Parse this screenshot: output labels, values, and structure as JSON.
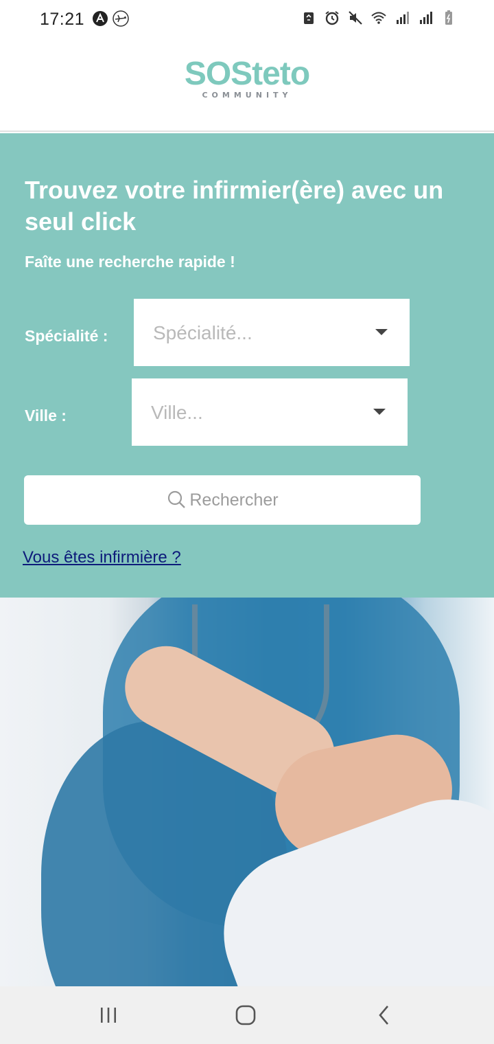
{
  "status_bar": {
    "time": "17:21",
    "left_icons": [
      "app-a-icon",
      "airplane-icon"
    ],
    "right_icons": [
      "recycle-notification-icon",
      "alarm-icon",
      "mute-icon",
      "wifi-icon",
      "signal-icon",
      "signal-icon",
      "battery-icon"
    ]
  },
  "header": {
    "logo_main": "SOSteto",
    "logo_sub": "COMMUNITY"
  },
  "search": {
    "headline": "Trouvez votre infirmier(ère) avec un seul click",
    "subline": "Faîte une recherche rapide !",
    "specialite_label": "Spécialité :",
    "specialite_placeholder": "Spécialité...",
    "ville_label": "Ville :",
    "ville_placeholder": "Ville...",
    "button_label": "Rechercher",
    "nurse_link": "Vous êtes infirmière ?"
  },
  "nav": {
    "items": [
      "recent-apps-icon",
      "home-icon",
      "back-icon"
    ]
  },
  "colors": {
    "accent": "#85c7bf",
    "logo": "#7ec9bd",
    "link": "#0d1b7a"
  }
}
